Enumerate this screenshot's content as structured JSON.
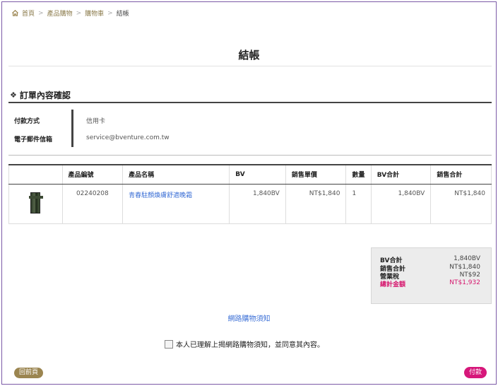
{
  "breadcrumb": {
    "items": [
      "首頁",
      "產品購物",
      "購物車"
    ],
    "current": "結帳",
    "separator": ">"
  },
  "page_title": "結帳",
  "section_title": "訂單內容確認",
  "info": {
    "payment_label": "付款方式",
    "payment_value": "信用卡",
    "email_label": "電子郵件信箱",
    "email_value": "service@bventure.com.tw"
  },
  "table": {
    "headers": [
      "",
      "產品編號",
      "產品名稱",
      "BV",
      "銷售單價",
      "數量",
      "BV合計",
      "銷售合計"
    ],
    "rows": [
      {
        "code": "02240208",
        "name": "青春駐顏煥膚舒適晚霜",
        "bv": "1,840BV",
        "price": "NT$1,840",
        "qty": "1",
        "bv_total": "1,840BV",
        "sales_total": "NT$1,840"
      }
    ]
  },
  "summary": {
    "bv_label": "BV合計",
    "bv_value": "1,840BV",
    "sales_label": "銷售合計",
    "sales_value": "NT$1,840",
    "tax_label": "營業稅",
    "tax_value": "NT$92",
    "total_label": "總計金額",
    "total_value": "NT$1,932"
  },
  "notice_link": "網路購物須知",
  "agree_text": "本人已理解上揭網路購物須知，並同意其內容。",
  "buttons": {
    "back": "回前頁",
    "pay": "付款"
  },
  "colors": {
    "brand_gold": "#9b8550",
    "pay_pink": "#d6177a",
    "link_blue": "#3b6fd6",
    "frame_purple": "#7b5aa6"
  },
  "icons": [
    "home-icon",
    "diamond-icon"
  ]
}
